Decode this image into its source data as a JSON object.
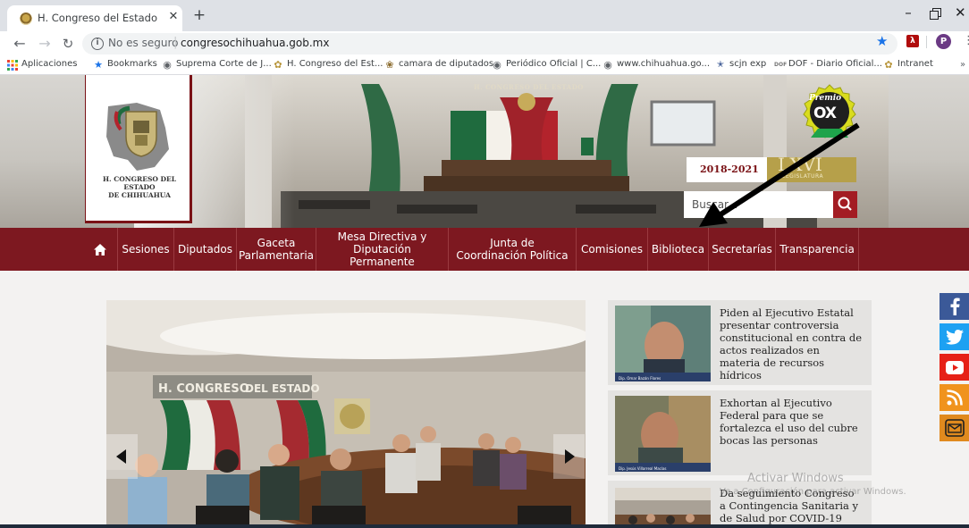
{
  "browser": {
    "tab_title": "H. Congreso del Estado de Chihu",
    "tab_close": "✕",
    "new_tab": "+",
    "security_label": "No es seguro",
    "url": "congresochihuahua.gob.mx",
    "profile_initial": "P",
    "bookmarks": [
      {
        "label": "Aplicaciones",
        "icon": "apps-grid-icon"
      },
      {
        "label": "Bookmarks",
        "icon": "star-icon"
      },
      {
        "label": "Suprema Corte de J...",
        "icon": "globe-icon"
      },
      {
        "label": "H. Congreso del Est...",
        "icon": "congreso-favicon-icon"
      },
      {
        "label": "camara de diputados",
        "icon": "camara-favicon-icon"
      },
      {
        "label": "Periódico Oficial | C...",
        "icon": "globe-icon"
      },
      {
        "label": "www.chihuahua.go...",
        "icon": "globe-icon"
      },
      {
        "label": "scjn exp",
        "icon": "scjn-favicon-icon"
      },
      {
        "label": "DOF - Diario Oficial...",
        "icon": "dof-favicon-icon"
      },
      {
        "label": "Intranet",
        "icon": "congreso-favicon-icon"
      }
    ],
    "bookmarks_more": "»"
  },
  "header": {
    "logo_text_line1": "H. CONGRESO DEL ESTADO",
    "logo_text_line2": "DE CHIHUAHUA",
    "banner_text": "H. CONGRESO DEL ESTADO",
    "premio_label": "Premio",
    "premio_mark": "OX",
    "legislatura_years": "2018-2021",
    "legislatura_number": "LXVI",
    "legislatura_word": "LEGISLATURA",
    "search_placeholder": "Buscar..."
  },
  "nav": {
    "items": [
      {
        "label": "Sesiones"
      },
      {
        "label": "Diputados"
      },
      {
        "label": "Gaceta Parlamentaria"
      },
      {
        "label": "Mesa Directiva y Diputación Permanente"
      },
      {
        "label": "Junta de Coordinación Política"
      },
      {
        "label": "Comisiones"
      },
      {
        "label": "Biblioteca"
      },
      {
        "label": "Secretarías"
      },
      {
        "label": "Transparencia"
      }
    ]
  },
  "carousel": {
    "sign_text_1": "H. CONGRESO",
    "sign_text_2": "DEL ESTADO"
  },
  "news": [
    {
      "title": "Piden al Ejecutivo Estatal presentar controversia constitucional en contra de actos realizados en materia de recursos hídricos",
      "caption": "Dip. Omar Bazán Flores"
    },
    {
      "title": "Exhortan al Ejecutivo Federal para que se fortalezca el uso del cubre bocas las personas",
      "caption": "Dip. Jesús Villarreal Macías"
    },
    {
      "title": "Da seguimiento Congreso a Contingencia Sanitaria y de Salud por COVID-19",
      "caption": ""
    }
  ],
  "watermark": {
    "line1": "Activar Windows",
    "line2": "Ve a Configuración para activar Windows."
  },
  "social": [
    {
      "name": "facebook",
      "color": "#3b5998"
    },
    {
      "name": "twitter",
      "color": "#1da1f2"
    },
    {
      "name": "youtube",
      "color": "#e62117"
    },
    {
      "name": "rss",
      "color": "#f0931d"
    },
    {
      "name": "email",
      "color": "#e08a1e"
    }
  ],
  "colors": {
    "brand_maroon": "#7d1820",
    "search_red": "#a31c23",
    "gold": "#b6a04a",
    "chrome_tab_strip": "#dee1e6",
    "bookmark_star": "#1a73e8"
  }
}
